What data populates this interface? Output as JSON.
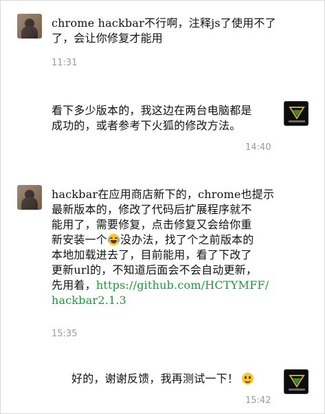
{
  "messages": [
    {
      "side": "left",
      "lines": [
        "chrome hackbar不行啊，注释js了使用不了",
        "了，会让你修复才能用"
      ],
      "time": "11:31"
    },
    {
      "side": "right",
      "lines": [
        "看下多少版本的，我这边在两台电脑都是",
        "成功的，或者参考下火狐的修改方法。"
      ],
      "time": "14:40"
    },
    {
      "side": "left",
      "lines": [
        "hackbar在应用商店新下的，chrome也提示",
        "最新版本的，修改了代码后扩展程序就不",
        "能用了，需要修复，点击修复又会给你重",
        "新安装一个",
        "没办法，找了个之前版本的",
        "本地加载进去了，目前能用，看了下改了",
        "更新url的，不知道后面会不会自动更新，",
        "先用着，",
        "https://github.com/HCTYMFF/",
        "hackbar2.1.3"
      ],
      "time": "15:35",
      "emojis": [
        "tears-of-joy-emoji"
      ],
      "link_color": "#1a9a35"
    },
    {
      "side": "right",
      "lines": [
        "好的，谢谢反馈，我再测试一下！"
      ],
      "time": "15:42",
      "emojis": [
        "smile-emoji"
      ]
    }
  ],
  "avatars": {
    "user": "user-avatar",
    "developer": "developer-avatar"
  },
  "colors": {
    "timestamp": "#9b9b9b",
    "link": "#1a9a35",
    "text": "#111111"
  }
}
